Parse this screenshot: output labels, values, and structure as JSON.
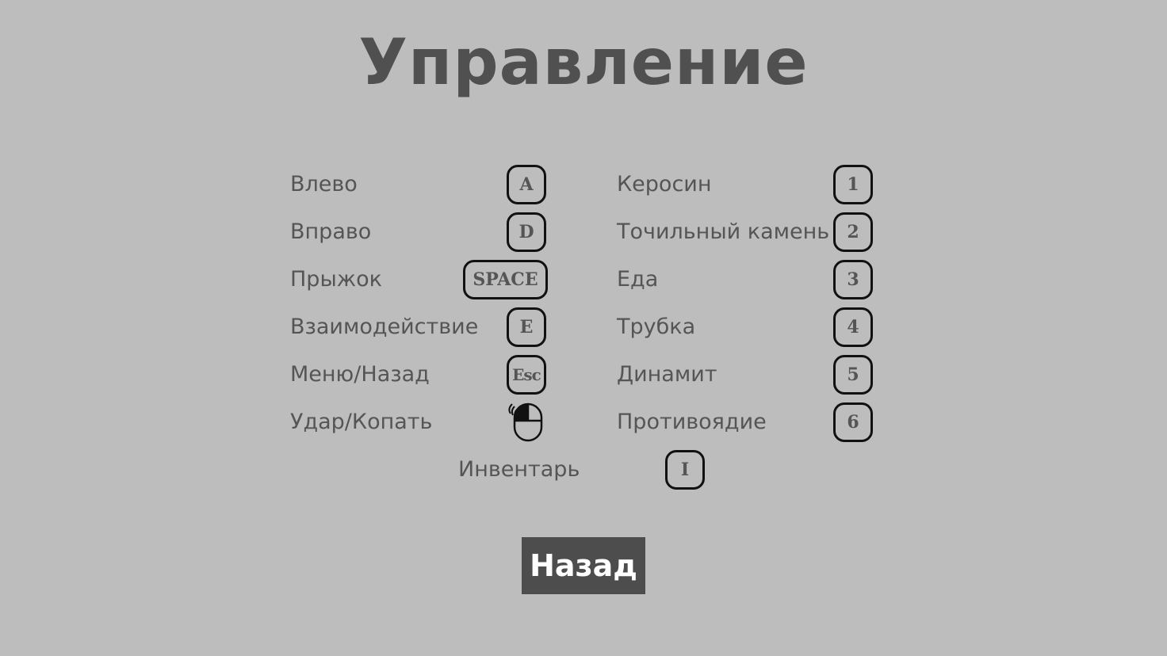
{
  "title": "Управление",
  "left_controls": [
    {
      "action": "Влево",
      "key": "A"
    },
    {
      "action": "Вправо",
      "key": "D"
    },
    {
      "action": "Прыжок",
      "key": "SPACE"
    },
    {
      "action": "Взаимодействие",
      "key": "E"
    },
    {
      "action": "Меню/Назад",
      "key": "Esc"
    },
    {
      "action": "Удар/Копать",
      "key": "",
      "icon": "mouse-left-click-icon"
    }
  ],
  "right_controls": [
    {
      "action": "Керосин",
      "key": "1"
    },
    {
      "action": "Точильный камень",
      "key": "2"
    },
    {
      "action": "Еда",
      "key": "3"
    },
    {
      "action": "Трубка",
      "key": "4"
    },
    {
      "action": "Динамит",
      "key": "5"
    },
    {
      "action": "Противоядие",
      "key": "6"
    }
  ],
  "center_control": {
    "action": "Инвентарь",
    "key": "I"
  },
  "back_button": "Назад",
  "colors": {
    "background": "#bdbdbd",
    "title": "#505050",
    "text": "#555555",
    "key_border": "#111111",
    "button_bg": "#4d4d4d",
    "button_text": "#ffffff"
  }
}
